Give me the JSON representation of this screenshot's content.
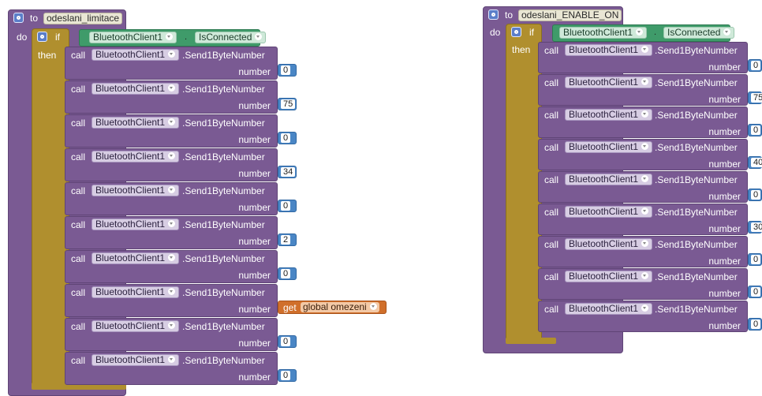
{
  "left_procedure": {
    "keyword_to": "to",
    "name": "odeslani_limitace",
    "keyword_do": "do",
    "if": {
      "keyword_if": "if",
      "keyword_then": "then",
      "condition": {
        "component": "BluetoothClient1",
        "property": "IsConnected"
      }
    },
    "calls": [
      {
        "keyword": "call",
        "component": "BluetoothClient1",
        "method": ".Send1ByteNumber",
        "param": "number",
        "value": "0"
      },
      {
        "keyword": "call",
        "component": "BluetoothClient1",
        "method": ".Send1ByteNumber",
        "param": "number",
        "value": "75"
      },
      {
        "keyword": "call",
        "component": "BluetoothClient1",
        "method": ".Send1ByteNumber",
        "param": "number",
        "value": "0"
      },
      {
        "keyword": "call",
        "component": "BluetoothClient1",
        "method": ".Send1ByteNumber",
        "param": "number",
        "value": "34"
      },
      {
        "keyword": "call",
        "component": "BluetoothClient1",
        "method": ".Send1ByteNumber",
        "param": "number",
        "value": "0"
      },
      {
        "keyword": "call",
        "component": "BluetoothClient1",
        "method": ".Send1ByteNumber",
        "param": "number",
        "value": "2"
      },
      {
        "keyword": "call",
        "component": "BluetoothClient1",
        "method": ".Send1ByteNumber",
        "param": "number",
        "value": "0"
      },
      {
        "keyword": "call",
        "component": "BluetoothClient1",
        "method": ".Send1ByteNumber",
        "param": "number",
        "get_keyword": "get",
        "get_var": "global omezeni"
      },
      {
        "keyword": "call",
        "component": "BluetoothClient1",
        "method": ".Send1ByteNumber",
        "param": "number",
        "value": "0"
      },
      {
        "keyword": "call",
        "component": "BluetoothClient1",
        "method": ".Send1ByteNumber",
        "param": "number",
        "value": "0"
      }
    ]
  },
  "right_procedure": {
    "keyword_to": "to",
    "name": "odeslani_ENABLE_ON",
    "keyword_do": "do",
    "if": {
      "keyword_if": "if",
      "keyword_then": "then",
      "condition": {
        "component": "BluetoothClient1",
        "property": "IsConnected"
      }
    },
    "calls": [
      {
        "keyword": "call",
        "component": "BluetoothClient1",
        "method": ".Send1ByteNumber",
        "param": "number",
        "value": "0"
      },
      {
        "keyword": "call",
        "component": "BluetoothClient1",
        "method": ".Send1ByteNumber",
        "param": "number",
        "value": "75"
      },
      {
        "keyword": "call",
        "component": "BluetoothClient1",
        "method": ".Send1ByteNumber",
        "param": "number",
        "value": "0"
      },
      {
        "keyword": "call",
        "component": "BluetoothClient1",
        "method": ".Send1ByteNumber",
        "param": "number",
        "value": "40"
      },
      {
        "keyword": "call",
        "component": "BluetoothClient1",
        "method": ".Send1ByteNumber",
        "param": "number",
        "value": "0"
      },
      {
        "keyword": "call",
        "component": "BluetoothClient1",
        "method": ".Send1ByteNumber",
        "param": "number",
        "value": "30"
      },
      {
        "keyword": "call",
        "component": "BluetoothClient1",
        "method": ".Send1ByteNumber",
        "param": "number",
        "value": "0"
      },
      {
        "keyword": "call",
        "component": "BluetoothClient1",
        "method": ".Send1ByteNumber",
        "param": "number",
        "value": "0"
      },
      {
        "keyword": "call",
        "component": "BluetoothClient1",
        "method": ".Send1ByteNumber",
        "param": "number",
        "value": "0"
      }
    ]
  },
  "colors": {
    "procedure": "#7a5a93",
    "control_if": "#b08f2e",
    "component_getter": "#3f9b6a",
    "math_number": "#4a86c5",
    "variable_get": "#d06f2b"
  },
  "icons": [
    "gear-icon",
    "mutator-gear-icon",
    "dropdown-arrow-icon"
  ]
}
